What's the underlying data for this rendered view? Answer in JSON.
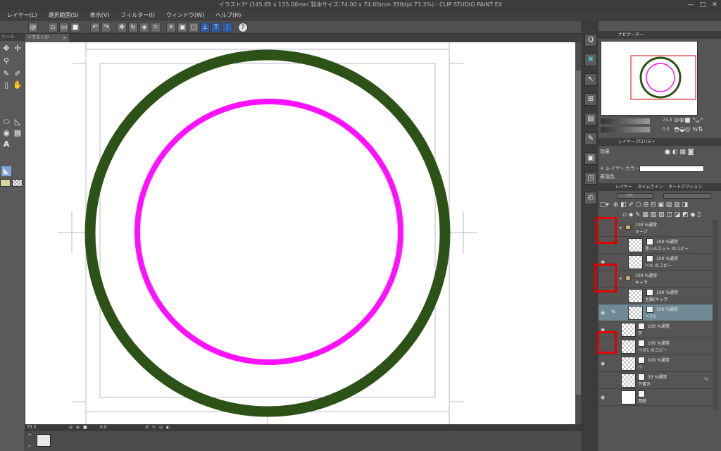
{
  "window": {
    "title": "イラスト3* (145.65 x 135.06mm 製本サイズ:74.00 x 74.00mm 350dpi 73.3%)  - CLIP STUDIO PAINT EX",
    "minimize": "—",
    "maximize": "□",
    "close": "✕"
  },
  "menubar": [
    "レイヤー(L)",
    "選択範囲(S)",
    "表示(V)",
    "フィルター(I)",
    "ウィンドウ(W)",
    "ヘルプ(H)"
  ],
  "tool_panel": {
    "header": "ツール"
  },
  "document_tab": {
    "label": "イラスト3*",
    "close": "×"
  },
  "status": {
    "zoom": "73.3",
    "angle": "0.0"
  },
  "navigator": {
    "tab_label": "ナビゲーター",
    "zoom": "73.3",
    "angle": "0.0"
  },
  "layer_property": {
    "tab_label": "レイヤープロパティ",
    "effect_label": "効果",
    "layer_color_label": "+ レイヤーカラー",
    "expression_color_label": "表現色"
  },
  "layers_panel": {
    "tab_label": "レイヤー",
    "tab2_label": "タイムライン",
    "tab3_label": "オートアクション",
    "blend_mode": "通常",
    "layers": [
      {
        "mode": "100 %通常",
        "name": "キープ",
        "type": "folder",
        "visible": false
      },
      {
        "mode": "100 %通常",
        "name": "黒シルエット のコピー",
        "type": "raster",
        "visible": false
      },
      {
        "mode": "100 %通常",
        "name": "べた のコピー",
        "type": "raster",
        "visible": true
      },
      {
        "mode": "100 %通常",
        "name": "キャラ",
        "type": "folder",
        "visible": false
      },
      {
        "mode": "100 %通常",
        "name": "主線(キャラ",
        "type": "raster",
        "visible": false
      },
      {
        "mode": "100 %通常",
        "name": "ベタ1",
        "type": "raster",
        "visible": true,
        "selected": true
      },
      {
        "mode": "100 %通常",
        "name": "字",
        "type": "raster",
        "visible": true
      },
      {
        "mode": "100 %通常",
        "name": "ベタ1 のコピー",
        "type": "raster",
        "visible": false
      },
      {
        "mode": "100 %通常",
        "name": "ベ",
        "type": "raster",
        "visible": true
      },
      {
        "mode": "33 %通常",
        "name": "下書き",
        "type": "raster",
        "visible": false
      },
      {
        "mode": "",
        "name": "用紙",
        "type": "paper",
        "visible": true
      }
    ]
  },
  "colors": {
    "outer_ring": "#2d5218",
    "inner_ring": "#ff10ff",
    "highlight": "#e00000",
    "selected_layer": "#6f8a95"
  }
}
